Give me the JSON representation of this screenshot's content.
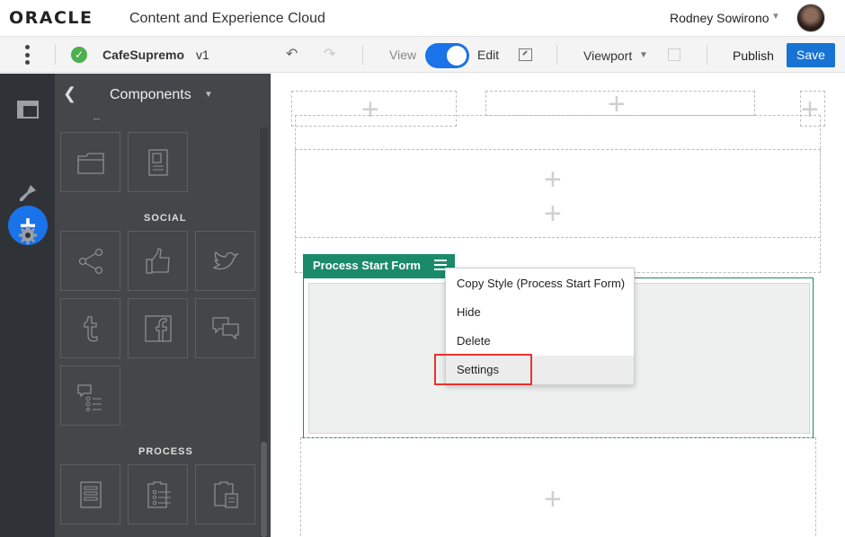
{
  "header": {
    "logo": "ORACLE",
    "app_title": "Content and Experience Cloud",
    "user_name": "Rodney Sowirono"
  },
  "toolbar": {
    "site_name": "CafeSupremo",
    "site_version": "v1",
    "view_label": "View",
    "edit_label": "Edit",
    "viewport_label": "Viewport",
    "publish_label": "Publish",
    "save_label": "Save",
    "edit_mode_on": true
  },
  "panel": {
    "title": "Components",
    "sections": [
      {
        "label": "SOCIAL",
        "tiles": [
          "share-icon",
          "like-icon",
          "twitter-icon",
          "tumblr-icon",
          "facebook-icon",
          "conversation-icon",
          "survey-icon"
        ]
      },
      {
        "label": "PROCESS",
        "tiles": [
          "form-icon",
          "task-list-icon",
          "task-details-icon"
        ]
      }
    ]
  },
  "canvas": {
    "component_label": "Process Start Form"
  },
  "context_menu": {
    "items": [
      "Copy Style (Process Start Form)",
      "Hide",
      "Delete",
      "Settings"
    ],
    "highlighted": "Settings"
  },
  "colors": {
    "accent": "#1a73e8",
    "component": "#1b8a6b",
    "highlight": "#e8322e",
    "rail": "#2f3236",
    "panel": "#444649"
  }
}
